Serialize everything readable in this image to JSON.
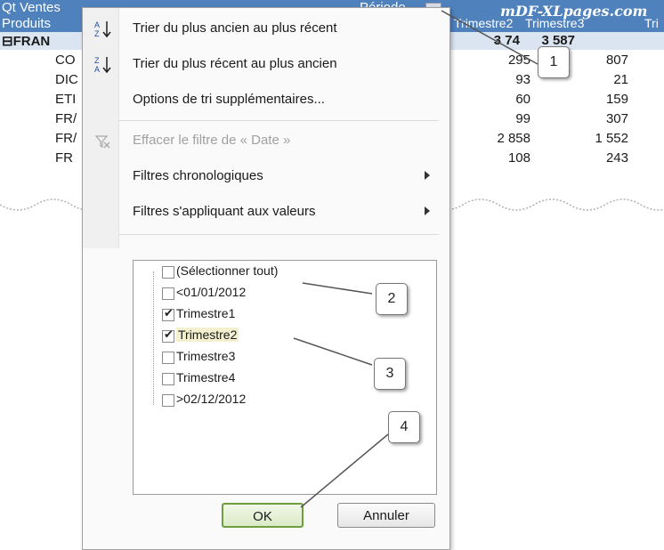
{
  "pivot": {
    "header_left": "Qt Ventes",
    "header_periode": "Période",
    "row2_produits": "Produits",
    "col_headers": [
      "Trimestre2",
      "Trimestre3",
      "Tri"
    ],
    "watermark": "mDF-XLpages.com",
    "rows": [
      {
        "label": "⊟FRAN",
        "v2": "3 74",
        "v3": "3 587"
      },
      {
        "label": "CO",
        "v2": "295",
        "v3": "807"
      },
      {
        "label": "DIC",
        "v2": "93",
        "v3": "21"
      },
      {
        "label": "ETI",
        "v2": "60",
        "v3": "159"
      },
      {
        "label": "FR/",
        "v2": "99",
        "v3": "307"
      },
      {
        "label": "FR/",
        "v2": "2 858",
        "v3": "1 552"
      },
      {
        "label": "FR",
        "v2": "108",
        "v3": "243"
      }
    ]
  },
  "menu": {
    "sort_asc": "Trier du plus ancien au plus récent",
    "sort_desc": "Trier du plus récent au plus ancien",
    "more_sort": "Options de tri supplémentaires...",
    "clear_filter": "Effacer le filtre de « Date »",
    "date_filters": "Filtres chronologiques",
    "value_filters": "Filtres s'appliquant aux valeurs"
  },
  "filter_list": [
    {
      "label": "(Sélectionner tout)",
      "checked": false
    },
    {
      "label": "<01/01/2012",
      "checked": false
    },
    {
      "label": "Trimestre1",
      "checked": true
    },
    {
      "label": "Trimestre2",
      "checked": true
    },
    {
      "label": "Trimestre3",
      "checked": false
    },
    {
      "label": "Trimestre4",
      "checked": false
    },
    {
      "label": ">02/12/2012",
      "checked": false
    }
  ],
  "buttons": {
    "ok": "OK",
    "cancel": "Annuler"
  },
  "callouts": [
    "1",
    "2",
    "3",
    "4"
  ],
  "colors": {
    "header_blue": "#4f81bd",
    "row_highlight": "#dbe5f1",
    "ok_border": "#6d9e3f"
  }
}
